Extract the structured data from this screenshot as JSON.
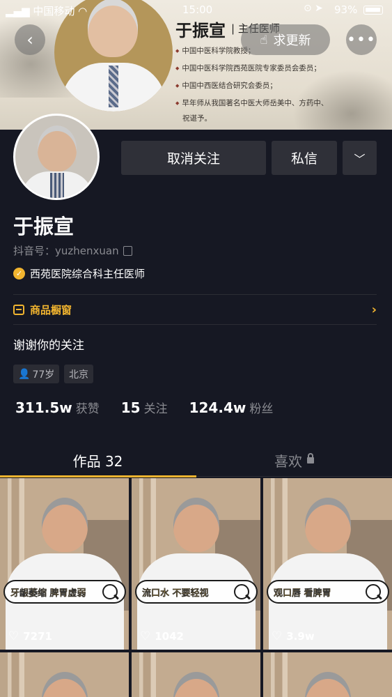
{
  "status_bar": {
    "carrier": "中国移动",
    "time": "15:00",
    "battery": "93%"
  },
  "banner": {
    "name": "于振宣",
    "title": "主任医师",
    "credentials": [
      "中国中医科学院教授；",
      "中国中医科学院西苑医院专家委员会委员；",
      "中国中西医结合研究会委员；",
      "早年师从我国著名中医大师岳美中、方药中、",
      "祝谌予。"
    ]
  },
  "header": {
    "update_label": "求更新"
  },
  "actions": {
    "unfollow_label": "取消关注",
    "message_label": "私信"
  },
  "profile": {
    "name": "于振宣",
    "douyin_id": "抖音号：yuzhenxuan",
    "verification": "西苑医院综合科主任医师",
    "shop_label": "商品橱窗",
    "bio": "谢谢你的关注",
    "tags": {
      "age": "77岁",
      "city": "北京"
    }
  },
  "stats": [
    {
      "value": "311.5w",
      "label": "获赞"
    },
    {
      "value": "15",
      "label": "关注"
    },
    {
      "value": "124.4w",
      "label": "粉丝"
    }
  ],
  "tabs": {
    "works": "作品 32",
    "likes": "喜欢"
  },
  "videos": [
    {
      "caption": "牙龈萎缩 脾胃虚弱",
      "likes": "7271"
    },
    {
      "caption": "流口水 不要轻视",
      "likes": "1042"
    },
    {
      "caption": "观口唇 看脾胃",
      "likes": "3.9w"
    }
  ],
  "colors": {
    "background": "#161823",
    "accent": "#f1b42f",
    "button": "#2f3038",
    "muted_text": "#8a8b91"
  }
}
